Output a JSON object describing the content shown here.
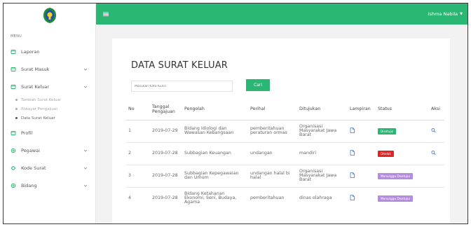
{
  "colors": {
    "accent": "#2ab673",
    "approved": "#2ab673",
    "rejected": "#e02424",
    "waiting": "#b58be0",
    "link": "#3b7dd8"
  },
  "sidebar": {
    "menu_label": "MENU",
    "items": [
      {
        "label": "Laporan",
        "icon": "laporan-icon",
        "chevron": false
      },
      {
        "label": "Surat Masuk",
        "icon": "mail-in-icon",
        "chevron": true
      },
      {
        "label": "Surat Keluar",
        "icon": "mail-out-icon",
        "chevron": true
      },
      {
        "label": "Profil",
        "icon": "profile-icon",
        "chevron": false
      },
      {
        "label": "Pegawai",
        "icon": "employee-icon",
        "chevron": true
      },
      {
        "label": "Kode Surat",
        "icon": "code-icon",
        "chevron": true
      },
      {
        "label": "Bidang",
        "icon": "division-icon",
        "chevron": true
      }
    ],
    "sub_items": [
      {
        "label": "Tambah Surat Keluar"
      },
      {
        "label": "Riwayat Pengajuan"
      },
      {
        "label": "Data Surat Keluar"
      }
    ]
  },
  "topbar": {
    "user_name": "Ishma Nabila",
    "caret": "▼"
  },
  "main": {
    "title": "DATA SURAT KELUAR",
    "search_placeholder": "Masukan Kata Kunci",
    "search_button": "Cari",
    "columns": [
      "No",
      "Tanggal Pengajuan",
      "Pengolah",
      "Perihal",
      "Ditujukan",
      "Lampiran",
      "Status",
      "Aksi"
    ],
    "rows": [
      {
        "no": "1",
        "tanggal": "2019-07-29",
        "pengolah": "Bidang Idiologi dan Wawasan Kebangsaan",
        "perihal": "pemberitahuan peraturan ormas",
        "ditujukan": "Organisasi Masyarakat Jawa Barat",
        "status": "Disetujui",
        "status_type": "approved",
        "has_action": true
      },
      {
        "no": "2",
        "tanggal": "2019-07-28",
        "pengolah": "Subbagian Keuangan",
        "perihal": "undangan",
        "ditujukan": "mandiri",
        "status": "Ditolak",
        "status_type": "rejected",
        "has_action": true
      },
      {
        "no": "3",
        "tanggal": "2019-07-28",
        "pengolah": "Subbagian Kepegawaian dan Umum",
        "perihal": "undangan halal bi halal",
        "ditujukan": "Organisasi Masyarakat Jawa Barat",
        "status": "Menunggu Disetujui",
        "status_type": "waiting",
        "has_action": false
      },
      {
        "no": "4",
        "tanggal": "2019-07-28",
        "pengolah": "Bidang Ketahanan Ekonomi, Seni, Budaya, Agama",
        "perihal": "pemberitahuan",
        "ditujukan": "dinas olahraga",
        "status": "Menunggu Disetujui",
        "status_type": "waiting",
        "has_action": false
      }
    ]
  }
}
